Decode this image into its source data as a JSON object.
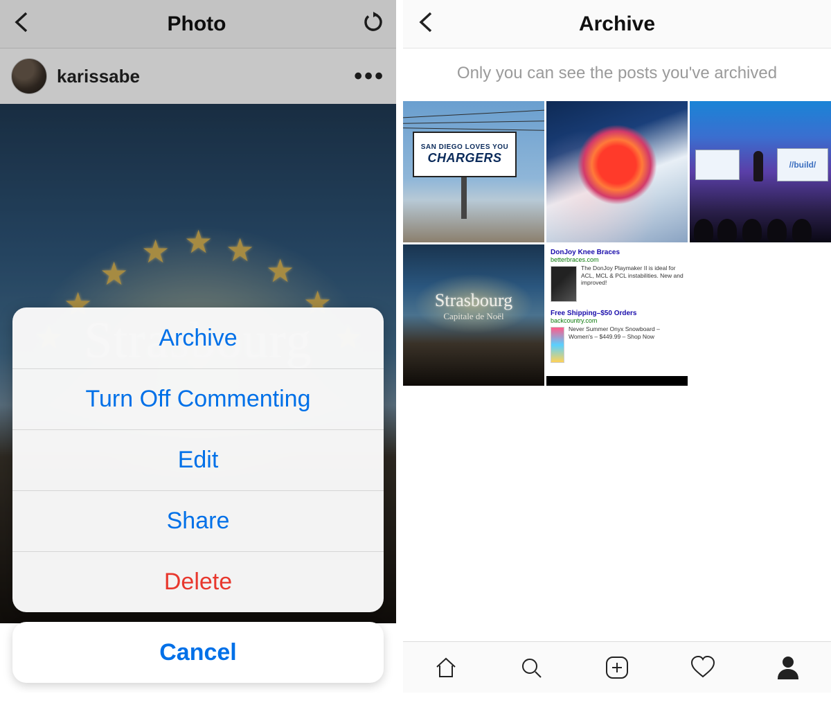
{
  "left": {
    "header_title": "Photo",
    "username": "karissabe",
    "more_dots": "•••",
    "photo_overlay_text": "Strasbourg",
    "action_sheet": {
      "items": [
        {
          "label": "Archive",
          "destructive": false
        },
        {
          "label": "Turn Off Commenting",
          "destructive": false
        },
        {
          "label": "Edit",
          "destructive": false
        },
        {
          "label": "Share",
          "destructive": false
        },
        {
          "label": "Delete",
          "destructive": true
        }
      ],
      "cancel_label": "Cancel"
    }
  },
  "right": {
    "header_title": "Archive",
    "hint_text": "Only you can see the posts you've archived",
    "thumbs": {
      "t1_line1": "SAN DIEGO LOVES YOU",
      "t1_line2": "CHARGERS",
      "t3_screen_right": "//build/",
      "t4_script": "Strasbourg",
      "t4_sub": "Capitale de Noël",
      "t5_ad1_title": "DonJoy Knee Braces",
      "t5_ad1_url": "betterbraces.com",
      "t5_ad1_desc": "The DonJoy Playmaker II is ideal for ACL, MCL & PCL instabilities. New and improved!",
      "t5_ad2_title": "Free Shipping–$50 Orders",
      "t5_ad2_url": "backcountry.com",
      "t5_ad2_desc": "Never Summer Onyx Snowboard – Women's – $449.99 – Shop Now"
    },
    "nav_icons": [
      "home",
      "search",
      "new-post",
      "activity",
      "profile"
    ]
  }
}
